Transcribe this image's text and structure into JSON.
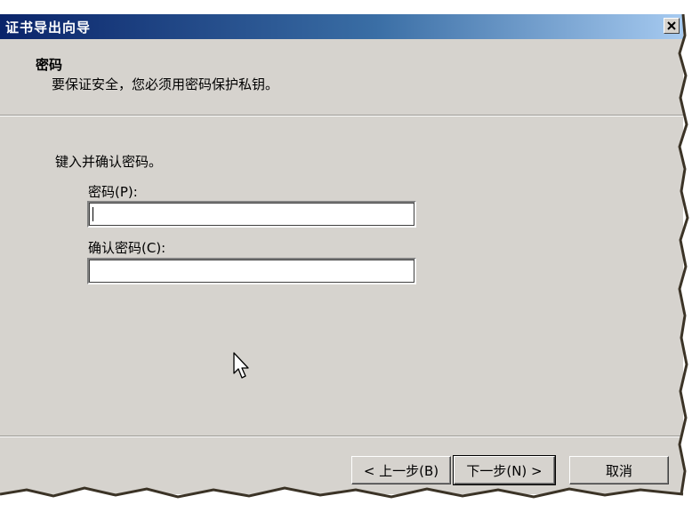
{
  "window": {
    "title": "证书导出向导"
  },
  "header": {
    "title": "密码",
    "subtitle": "要保证安全，您必须用密码保护私钥。"
  },
  "body": {
    "instruction": "键入并确认密码。",
    "password_label": "密码(P):",
    "password_value": "",
    "confirm_label": "确认密码(C):",
    "confirm_value": ""
  },
  "buttons": {
    "back": "< 上一步(B)",
    "next": "下一步(N) >",
    "cancel": "取消"
  },
  "icons": {
    "close": "close-icon",
    "cursor": "mouse-pointer-icon"
  },
  "colors": {
    "title_bar_start": "#0a246a",
    "title_bar_end": "#a6caf0",
    "dialog_background": "#d6d3ce"
  }
}
